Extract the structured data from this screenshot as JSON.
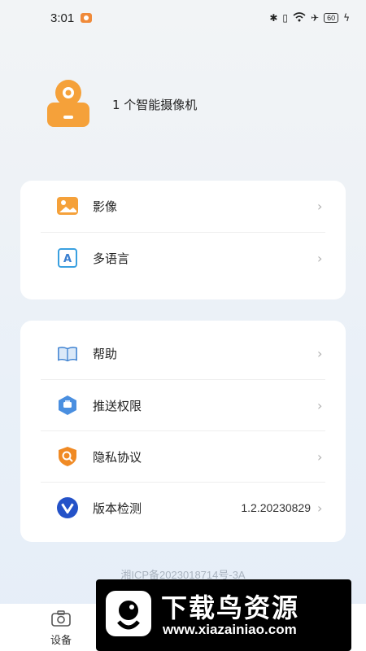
{
  "status_bar": {
    "time": "3:01",
    "battery": "60"
  },
  "profile": {
    "text": "1 个智能摄像机"
  },
  "menu_group_1": [
    {
      "label": "影像",
      "icon": "image-icon"
    },
    {
      "label": "多语言",
      "icon": "language-icon"
    }
  ],
  "menu_group_2": [
    {
      "label": "帮助",
      "icon": "help-book-icon"
    },
    {
      "label": "推送权限",
      "icon": "push-permission-icon"
    },
    {
      "label": "隐私协议",
      "icon": "privacy-icon"
    },
    {
      "label": "版本检测",
      "icon": "version-icon",
      "value": "1.2.20230829"
    }
  ],
  "icp": "湘ICP备2023018714号-3A",
  "tabbar": {
    "device_label": "设备"
  },
  "watermark": {
    "title": "下载鸟资源",
    "url": "www.xiazainiao.com"
  },
  "colors": {
    "accent_orange": "#f5a13a",
    "icon_blue": "#4a8fe0"
  }
}
